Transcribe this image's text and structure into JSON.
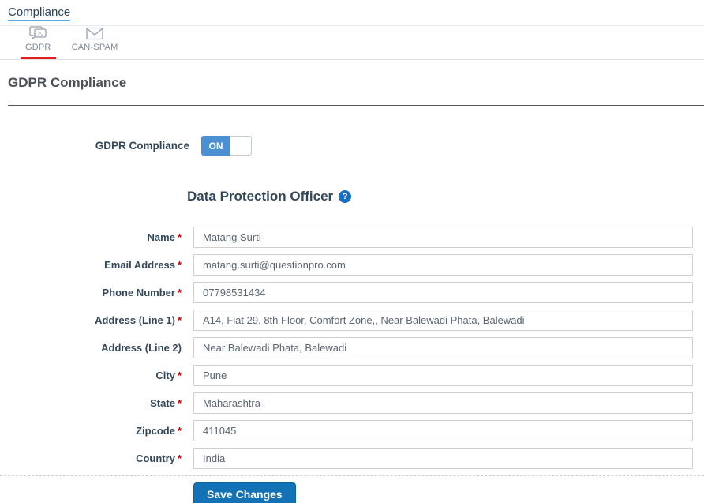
{
  "breadcrumb": {
    "label": "Compliance"
  },
  "tabs": {
    "gdpr": {
      "label": "GDPR"
    },
    "canspam": {
      "label": "CAN-SPAM"
    }
  },
  "page": {
    "title": "GDPR Compliance"
  },
  "toggle": {
    "label": "GDPR Compliance",
    "state": "ON"
  },
  "section": {
    "title": "Data Protection Officer",
    "help_glyph": "?"
  },
  "required_marker": "*",
  "fields": [
    {
      "label": "Name",
      "required": true,
      "value": "Matang Surti"
    },
    {
      "label": "Email Address",
      "required": true,
      "value": "matang.surti@questionpro.com"
    },
    {
      "label": "Phone Number",
      "required": true,
      "value": "07798531434"
    },
    {
      "label": "Address (Line 1)",
      "required": true,
      "value": "A14, Flat 29, 8th Floor, Comfort Zone,, Near Balewadi Phata, Balewadi"
    },
    {
      "label": "Address (Line 2)",
      "required": false,
      "value": "Near Balewadi Phata, Balewadi"
    },
    {
      "label": "City",
      "required": true,
      "value": "Pune"
    },
    {
      "label": "State",
      "required": true,
      "value": "Maharashtra"
    },
    {
      "label": "Zipcode",
      "required": true,
      "value": "411045"
    },
    {
      "label": "Country",
      "required": true,
      "value": "India"
    }
  ],
  "actions": {
    "save": "Save Changes"
  },
  "colors": {
    "accent_blue": "#1272b5",
    "toggle_blue": "#4a90d2",
    "active_tab_red": "#e02020",
    "required_red": "#cc0000",
    "heading_navy": "#33475b"
  }
}
